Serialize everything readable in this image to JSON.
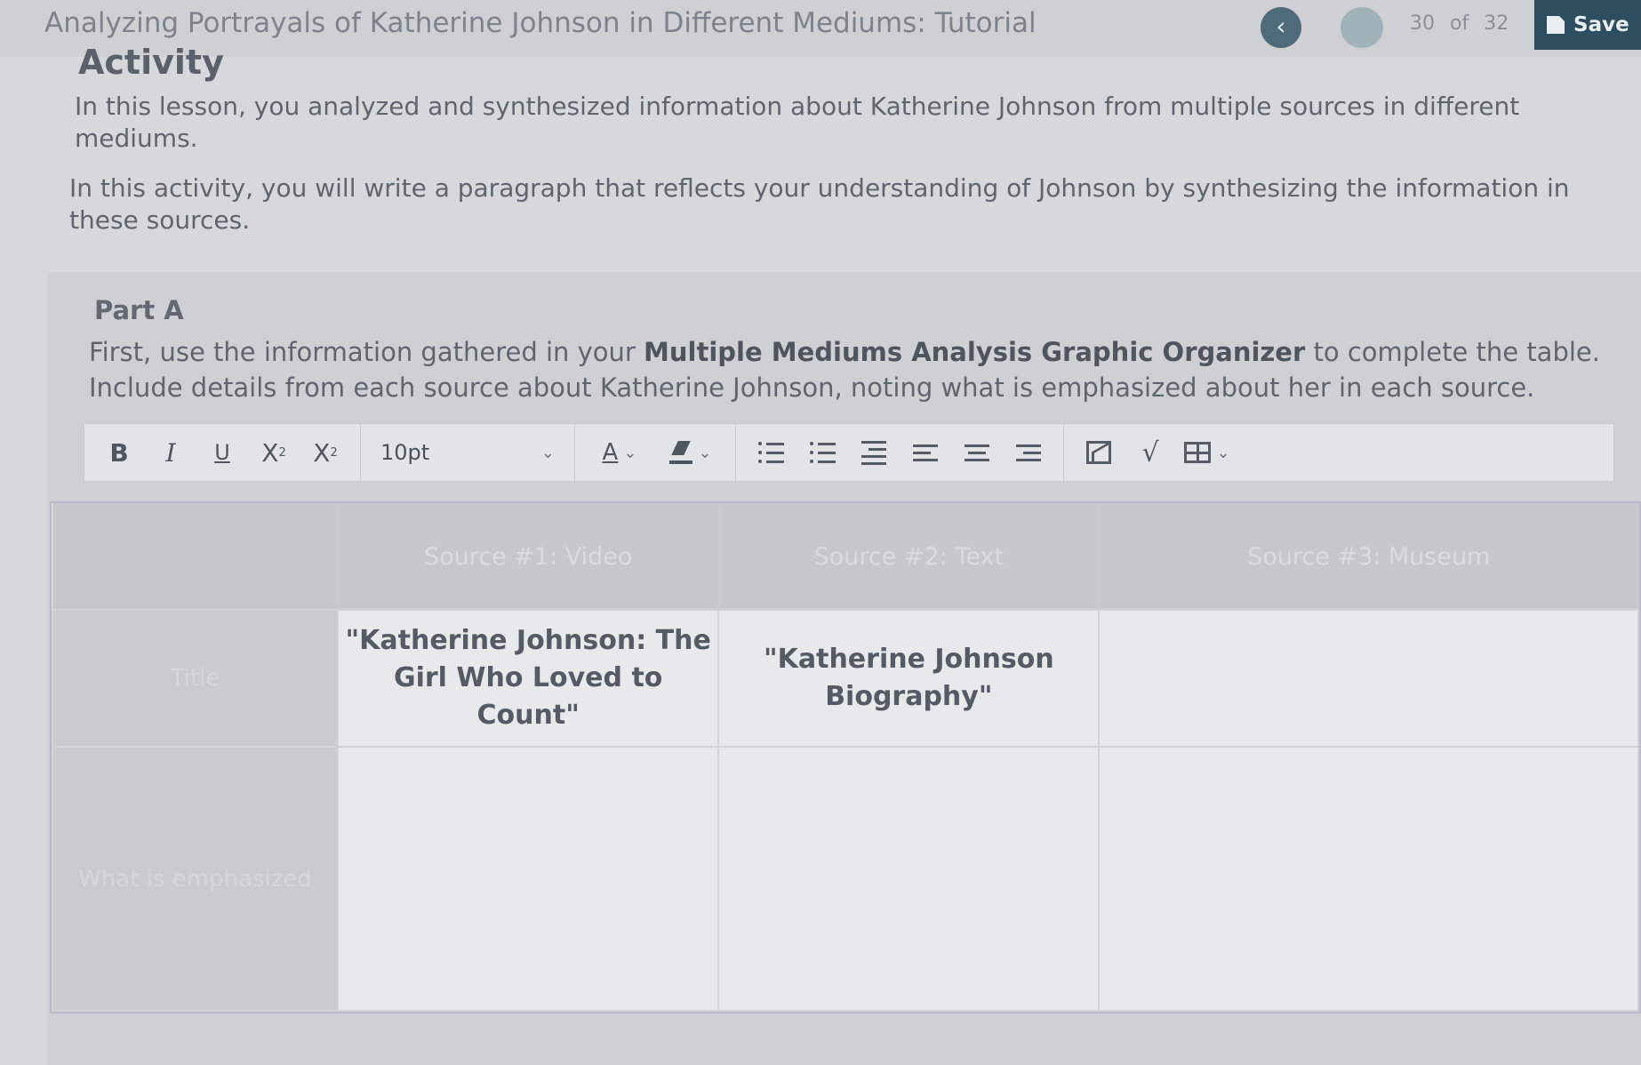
{
  "header": {
    "title": "Analyzing Portrayals of Katherine Johnson in Different Mediums: Tutorial",
    "back_icon": "chevron-left-icon",
    "current": "30",
    "of_label": "of",
    "total": "32",
    "save_label": "Save"
  },
  "activity": {
    "heading": "Activity",
    "paragraph1": "In this lesson, you analyzed and synthesized information about Katherine Johnson from multiple sources in different mediums.",
    "paragraph2": "In this activity, you will write a paragraph that reflects your understanding of Johnson by synthesizing the information in these sources."
  },
  "partA": {
    "label": "Part A",
    "instr_before": "First, use the information gathered in your ",
    "instr_bold": "Multiple Mediums Analysis Graphic Organizer",
    "instr_after": " to complete the table. Include details from each source about Katherine Johnson, noting what is emphasized about her in each source."
  },
  "toolbar": {
    "bold": "B",
    "italic": "I",
    "underline": "U",
    "font_size": "10pt"
  },
  "table": {
    "headers": [
      "",
      "Source #1: Video",
      "Source #2: Text",
      "Source #3: Museum"
    ],
    "row1": {
      "label": "Title",
      "cells": [
        "\"Katherine Johnson: The Girl Who Loved to Count\"",
        "\"Katherine Johnson Biography\"",
        ""
      ]
    },
    "row2": {
      "label": "What is emphasized",
      "cells": [
        "",
        "",
        ""
      ]
    }
  }
}
